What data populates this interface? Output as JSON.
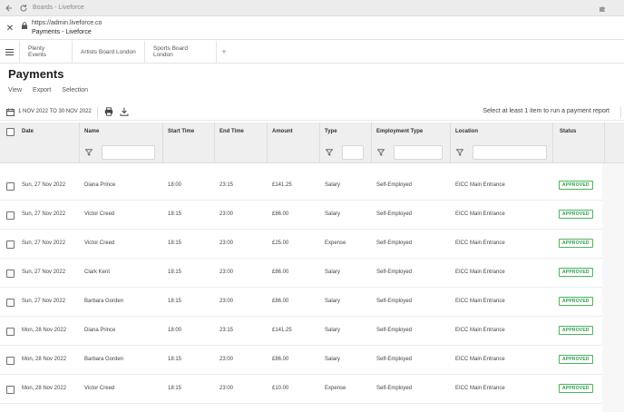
{
  "browser": {
    "tab_title": "Boards - Liveforce",
    "url": "https://admin.liveforce.co",
    "page_title": "Payments - Liveforce"
  },
  "tabs": [
    {
      "label": "Plenty Events"
    },
    {
      "label": "Artists Board London"
    },
    {
      "label": "Sports Board London"
    }
  ],
  "page": {
    "title": "Payments",
    "actions": [
      "View",
      "Export",
      "Selection"
    ]
  },
  "filterbar": {
    "date_range": "1 NOV 2022 TO 30 NOV 2022",
    "hint": "Select at least 1 item to run a payment report"
  },
  "columns": [
    "Date",
    "Name",
    "Start Time",
    "End Time",
    "Amount",
    "Type",
    "Employment Type",
    "Location",
    "Status"
  ],
  "rows": [
    {
      "date": "Sun, 27 Nov 2022",
      "name": "Diana Prince",
      "start": "18:00",
      "end": "23:15",
      "amount": "£141.25",
      "type": "Salary",
      "employment": "Self-Employed",
      "location": "EICC Main Entrance",
      "status": "APPROVED"
    },
    {
      "date": "Sun, 27 Nov 2022",
      "name": "Victor Creed",
      "start": "18:15",
      "end": "23:00",
      "amount": "£86.00",
      "type": "Salary",
      "employment": "Self-Employed",
      "location": "EICC Main Entrance",
      "status": "APPROVED"
    },
    {
      "date": "Sun, 27 Nov 2022",
      "name": "Victor Creed",
      "start": "18:15",
      "end": "23:00",
      "amount": "£25.00",
      "type": "Expense",
      "employment": "Self-Employed",
      "location": "EICC Main Entrance",
      "status": "APPROVED"
    },
    {
      "date": "Sun, 27 Nov 2022",
      "name": "Clark Kent",
      "start": "18:15",
      "end": "23:00",
      "amount": "£86.00",
      "type": "Salary",
      "employment": "Self-Employed",
      "location": "EICC Main Entrance",
      "status": "APPROVED"
    },
    {
      "date": "Sun, 27 Nov 2022",
      "name": "Barbara Gorden",
      "start": "18:15",
      "end": "23:00",
      "amount": "£86.00",
      "type": "Salary",
      "employment": "Self-Employed",
      "location": "EICC Main Entrance",
      "status": "APPROVED"
    },
    {
      "date": "Mon, 28 Nov 2022",
      "name": "Diana Prince",
      "start": "18:00",
      "end": "23:15",
      "amount": "£141.25",
      "type": "Salary",
      "employment": "Self-Employed",
      "location": "EICC Main Entrance",
      "status": "APPROVED"
    },
    {
      "date": "Mon, 28 Nov 2022",
      "name": "Barbara Gorden",
      "start": "18:15",
      "end": "23:00",
      "amount": "£86.00",
      "type": "Salary",
      "employment": "Self-Employed",
      "location": "EICC Main Entrance",
      "status": "APPROVED"
    },
    {
      "date": "Mon, 28 Nov 2022",
      "name": "Victor Creed",
      "start": "18:15",
      "end": "23:00",
      "amount": "£10.00",
      "type": "Expense",
      "employment": "Self-Employed",
      "location": "EICC Main Entrance",
      "status": "APPROVED"
    }
  ],
  "colors": {
    "approved": "#2e9d48",
    "header_bg": "#efefef"
  },
  "icons": {
    "back": "arrow-left-icon",
    "reload": "reload-icon",
    "extension": "puzzle-icon",
    "close": "close-icon",
    "lock": "lock-icon",
    "menu": "hamburger-menu-icon",
    "add_tab": "plus-icon",
    "calendar": "calendar-icon",
    "print": "printer-icon",
    "download": "download-icon",
    "filter": "funnel-icon"
  }
}
